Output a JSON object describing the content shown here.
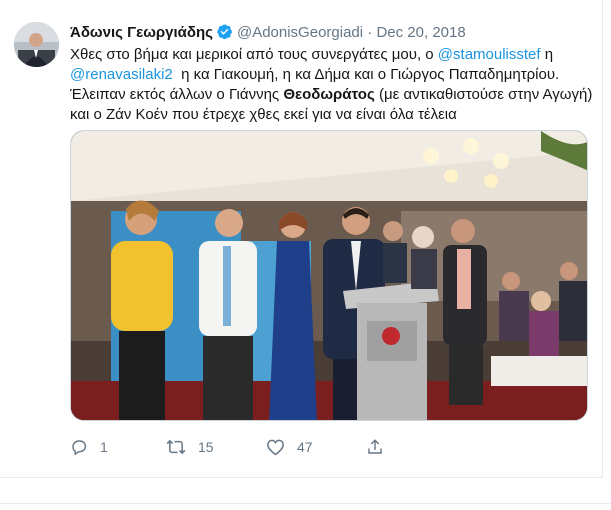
{
  "tweet": {
    "author_name": "Άδωνις Γεωργιάδης",
    "author_handle": "@AdonisGeorgiadi",
    "separator": "·",
    "date": "Dec 20, 2018",
    "text": {
      "part1": "Χθες στο βήμα και μερικοί από τους συνεργάτες μου, ο ",
      "mention1": "@stamoulisstef",
      "part2": " η",
      "mention2": "@renavasilaki2",
      "part3": "  η κα Γιακουμή, η κα Δήμα και ο Γιώργος Παπαδημητρίου.",
      "part4": "Έλειπαν εκτός άλλων ο Γιάννης ",
      "bold_name": "Θεοδωράτος",
      "part5": " (με αντικαθιστούσε στην Αγωγή) και ο Ζάν Κοέν που έτρεχε χθες εκεί για να είναι όλα τέλεια"
    },
    "actions": {
      "reply_count": "1",
      "retweet_count": "15",
      "like_count": "47",
      "share_count": ""
    },
    "icons": [
      "verified-badge-icon",
      "reply-icon",
      "retweet-icon",
      "like-icon",
      "share-icon"
    ],
    "colors": {
      "link": "#1b95e0",
      "muted": "#657786",
      "text": "#14171a",
      "verified": "#1da1f2"
    }
  }
}
